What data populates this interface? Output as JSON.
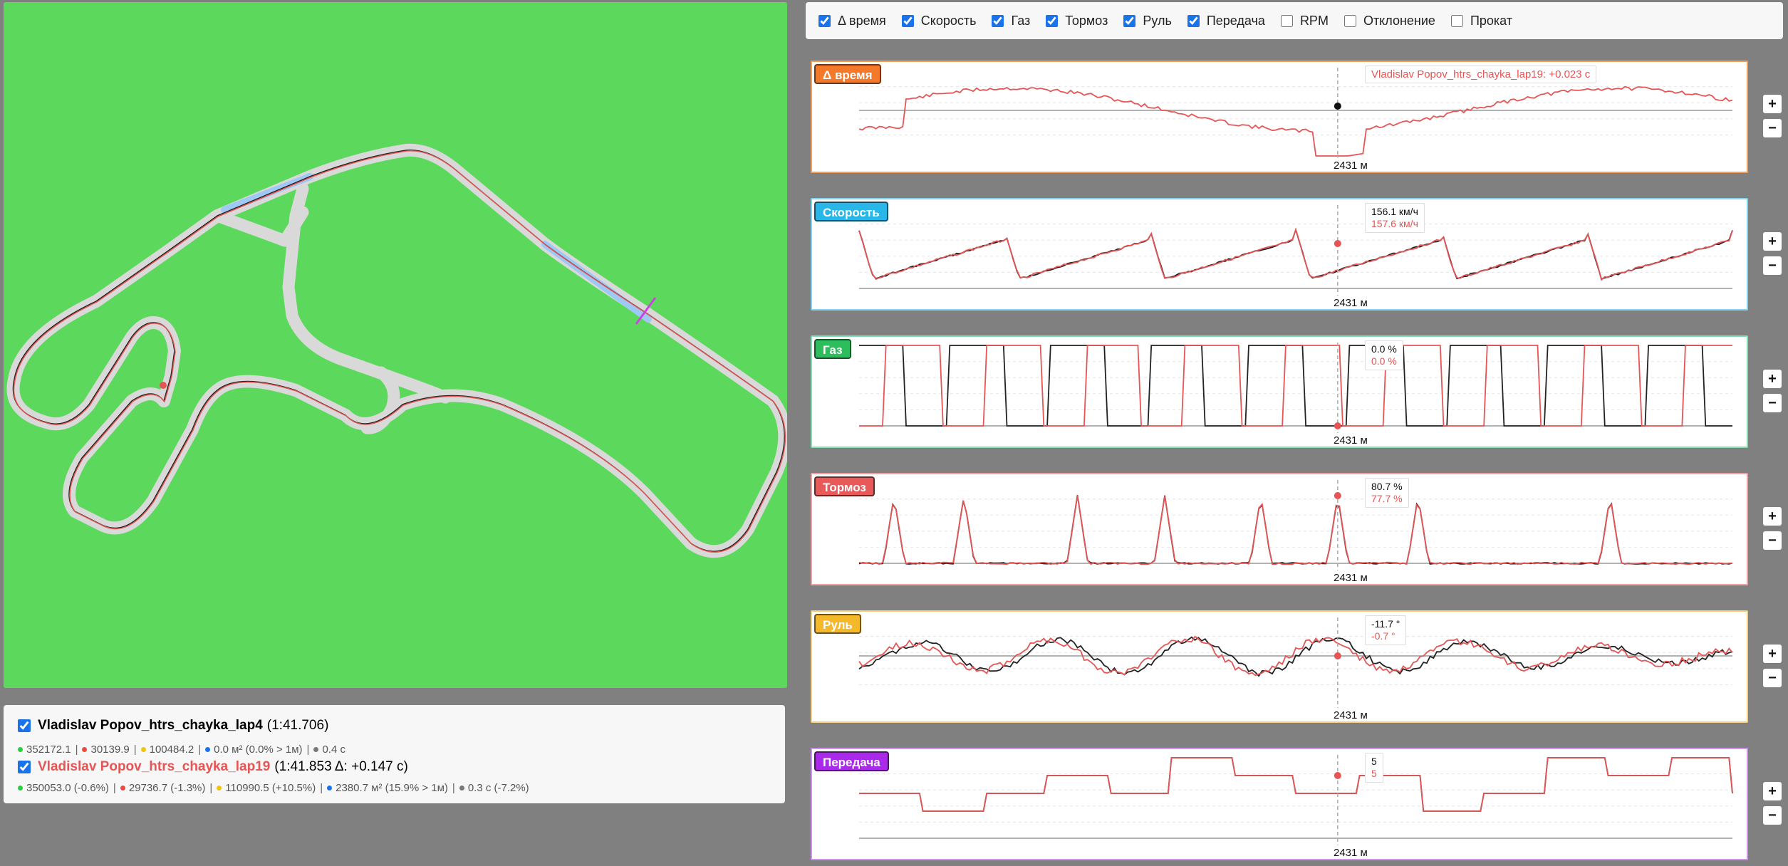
{
  "toolbar": {
    "items": [
      {
        "label": "Δ время",
        "checked": true
      },
      {
        "label": "Скорость",
        "checked": true
      },
      {
        "label": "Газ",
        "checked": true
      },
      {
        "label": "Тормоз",
        "checked": true
      },
      {
        "label": "Руль",
        "checked": true
      },
      {
        "label": "Передача",
        "checked": true
      },
      {
        "label": "RPM",
        "checked": false
      },
      {
        "label": "Отклонение",
        "checked": false
      },
      {
        "label": "Прокат",
        "checked": false
      }
    ]
  },
  "laps": [
    {
      "name": "Vladislav Popov_htrs_chayka_lap4",
      "info": "(1:41.706)",
      "color": "#000000",
      "checked": true,
      "stats": [
        {
          "text": "352172.1",
          "dot": "#2ecc40"
        },
        {
          "text": "30139.9",
          "dot": "#e74c3c"
        },
        {
          "text": "100484.2",
          "dot": "#f1c40f"
        },
        {
          "text": "0.0 м² (0.0% > 1м)",
          "dot": "#1a73e8"
        },
        {
          "text": "0.4 с",
          "dot": "#777777"
        }
      ]
    },
    {
      "name": "Vladislav Popov_htrs_chayka_lap19",
      "info": "(1:41.853 Δ: +0.147 с)",
      "color": "#e65555",
      "checked": true,
      "stats": [
        {
          "text": "350053.0 (-0.6%)",
          "dot": "#2ecc40"
        },
        {
          "text": "29736.7 (-1.3%)",
          "dot": "#e74c3c"
        },
        {
          "text": "110990.5 (+10.5%)",
          "dot": "#f1c40f"
        },
        {
          "text": "2380.7 м² (15.9% > 1м)",
          "dot": "#1a73e8"
        },
        {
          "text": "0.3 с (-7.2%)",
          "dot": "#777777"
        }
      ]
    }
  ],
  "cursor": {
    "distance_label": "2431 м",
    "fraction": 0.548
  },
  "charts": [
    {
      "key": "delta",
      "title": "Δ время",
      "tag_color": "#f5792a",
      "border_color": "#f5a05a",
      "tooltip_single": "Vladislav Popov_htrs_chayka_lap19: +0.023 с",
      "x_label": "2431 м",
      "zoom_in": "+",
      "zoom_out": "−"
    },
    {
      "key": "speed",
      "title": "Скорость",
      "tag_color": "#29b6e8",
      "border_color": "#7fd4f0",
      "tooltip_a": "156.1 км/ч",
      "tooltip_b": "157.6 км/ч",
      "x_label": "2431 м",
      "zoom_in": "+",
      "zoom_out": "−"
    },
    {
      "key": "throttle",
      "title": "Газ",
      "tag_color": "#2ebd5c",
      "border_color": "#7fe0b0",
      "tooltip_a": "0.0 %",
      "tooltip_b": "0.0 %",
      "x_label": "2431 м",
      "zoom_in": "+",
      "zoom_out": "−"
    },
    {
      "key": "brake",
      "title": "Тормоз",
      "tag_color": "#e85a5a",
      "border_color": "#f0a0a0",
      "tooltip_a": "80.7 %",
      "tooltip_b": "77.7 %",
      "x_label": "2431 м",
      "zoom_in": "+",
      "zoom_out": "−"
    },
    {
      "key": "steer",
      "title": "Руль",
      "tag_color": "#f5b82a",
      "border_color": "#f5d080",
      "tooltip_a": "-11.7 °",
      "tooltip_b": "-0.7 °",
      "x_label": "2431 м",
      "zoom_in": "+",
      "zoom_out": "−"
    },
    {
      "key": "gear",
      "title": "Передача",
      "tag_color": "#a92ae8",
      "border_color": "#d090f0",
      "tooltip_a": "5",
      "tooltip_b": "5",
      "x_label": "2431 м",
      "zoom_in": "+",
      "zoom_out": "−"
    }
  ]
}
